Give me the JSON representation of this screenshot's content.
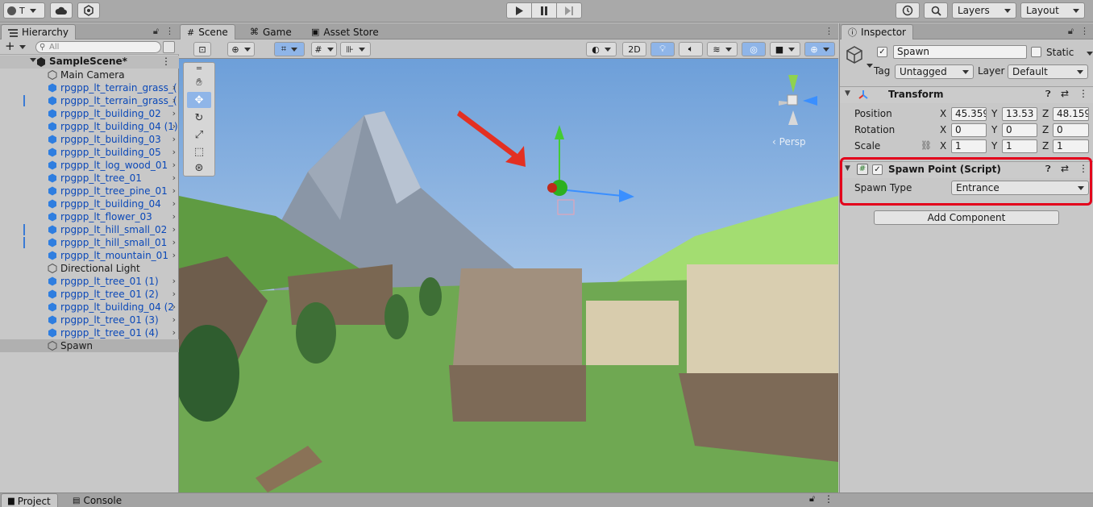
{
  "toolbar": {
    "account_label": "T",
    "layers_label": "Layers",
    "layout_label": "Layout"
  },
  "hierarchy": {
    "tab_label": "Hierarchy",
    "search_placeholder": "All",
    "scene_name": "SampleScene*",
    "items": [
      {
        "label": "Main Camera",
        "prefab": false
      },
      {
        "label": "rpgpp_lt_terrain_grass_(",
        "prefab": true
      },
      {
        "label": "rpgpp_lt_terrain_grass_(",
        "prefab": true
      },
      {
        "label": "rpgpp_lt_building_02",
        "prefab": true
      },
      {
        "label": "rpgpp_lt_building_04 (1)",
        "prefab": true
      },
      {
        "label": "rpgpp_lt_building_03",
        "prefab": true
      },
      {
        "label": "rpgpp_lt_building_05",
        "prefab": true
      },
      {
        "label": "rpgpp_lt_log_wood_01",
        "prefab": true
      },
      {
        "label": "rpgpp_lt_tree_01",
        "prefab": true
      },
      {
        "label": "rpgpp_lt_tree_pine_01",
        "prefab": true
      },
      {
        "label": "rpgpp_lt_building_04",
        "prefab": true
      },
      {
        "label": "rpgpp_lt_flower_03",
        "prefab": true
      },
      {
        "label": "rpgpp_lt_hill_small_02",
        "prefab": true
      },
      {
        "label": "rpgpp_lt_hill_small_01",
        "prefab": true
      },
      {
        "label": "rpgpp_lt_mountain_01",
        "prefab": true
      },
      {
        "label": "Directional Light",
        "prefab": false
      },
      {
        "label": "rpgpp_lt_tree_01 (1)",
        "prefab": true
      },
      {
        "label": "rpgpp_lt_tree_01 (2)",
        "prefab": true
      },
      {
        "label": "rpgpp_lt_building_04 (2",
        "prefab": true
      },
      {
        "label": "rpgpp_lt_tree_01 (3)",
        "prefab": true
      },
      {
        "label": "rpgpp_lt_tree_01 (4)",
        "prefab": true
      },
      {
        "label": "Spawn",
        "prefab": false
      }
    ]
  },
  "scene": {
    "tabs": [
      "Scene",
      "Game",
      "Asset Store"
    ],
    "mode_2d": "2D",
    "persp_label": "Persp"
  },
  "inspector": {
    "tab_label": "Inspector",
    "object_name": "Spawn",
    "static_label": "Static",
    "tag_label": "Tag",
    "tag_value": "Untagged",
    "layer_label": "Layer",
    "layer_value": "Default",
    "transform": {
      "title": "Transform",
      "position_label": "Position",
      "rotation_label": "Rotation",
      "scale_label": "Scale",
      "position": {
        "x": "45.359",
        "y": "13.53",
        "z": "48.159"
      },
      "rotation": {
        "x": "0",
        "y": "0",
        "z": "0"
      },
      "scale": {
        "x": "1",
        "y": "1",
        "z": "1"
      },
      "axis_x": "X",
      "axis_y": "Y",
      "axis_z": "Z"
    },
    "spawn_point": {
      "title": "Spawn Point (Script)",
      "field_label": "Spawn Type",
      "field_value": "Entrance"
    },
    "add_component_label": "Add Component"
  },
  "bottom": {
    "tabs": [
      "Project",
      "Console"
    ]
  }
}
